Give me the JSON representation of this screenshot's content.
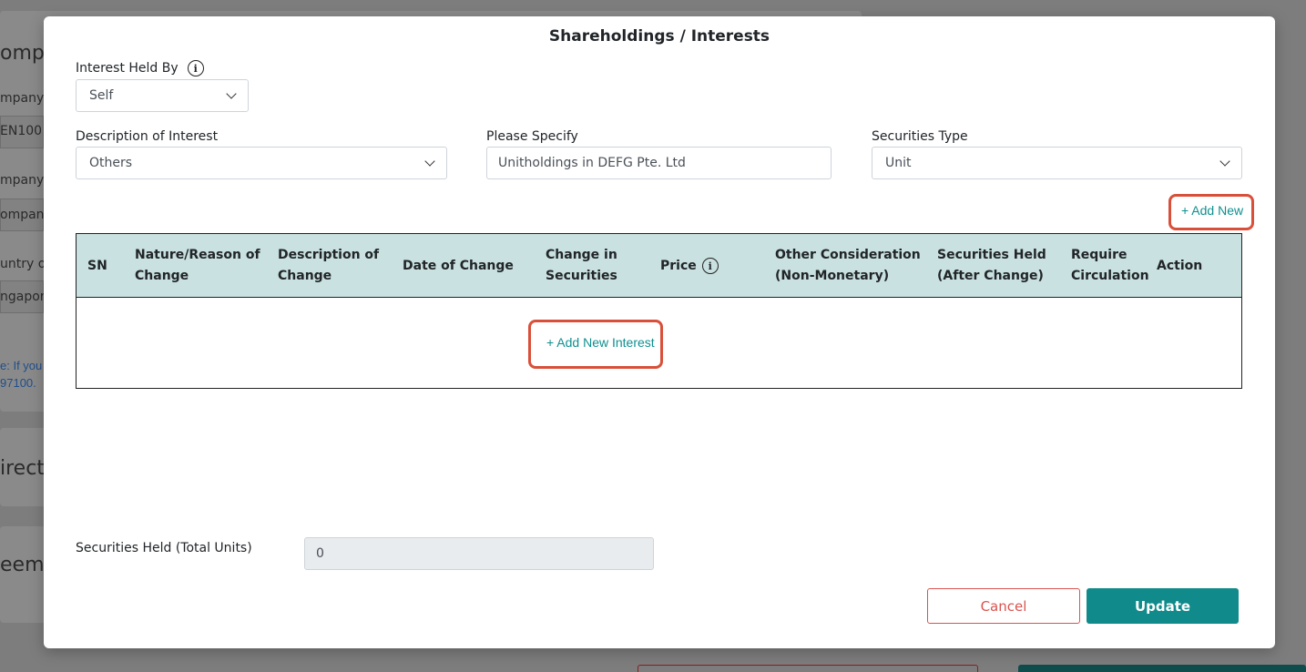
{
  "background": {
    "section_title": "ompa",
    "field1_label": "mpany",
    "field1_value": "EN100",
    "field2_label": "mpany",
    "field2_value": "ompan",
    "field3_label": "untry of",
    "field3_value": "ngapor",
    "note_line1": "e: If you",
    "note_line2": "97100.",
    "section2_title": "irect",
    "section3_title": "eeme"
  },
  "modal": {
    "title": "Shareholdings / Interests",
    "interest_held_by": {
      "label": "Interest Held By",
      "value": "Self"
    },
    "description_of_interest": {
      "label": "Description of Interest",
      "value": "Others"
    },
    "please_specify": {
      "label": "Please Specify",
      "value": "Unitholdings in DEFG Pte. Ltd"
    },
    "securities_type": {
      "label": "Securities Type",
      "value": "Unit"
    },
    "add_new_label": "+ Add New",
    "table": {
      "columns": [
        [
          "SN"
        ],
        [
          "Nature/Reason of",
          "Change"
        ],
        [
          "Description of",
          "Change"
        ],
        [
          "Date of Change"
        ],
        [
          "Change in",
          "Securities"
        ],
        [
          "Price"
        ],
        [
          "Other Consideration",
          "(Non-Monetary)"
        ],
        [
          "Securities Held",
          "(After Change)"
        ],
        [
          "Require",
          "Circulation"
        ],
        [
          "Action"
        ]
      ],
      "add_interest_label": "+ Add New Interest"
    },
    "securities_held_total": {
      "label": "Securities Held (Total Units)",
      "value": "0"
    },
    "cancel_label": "Cancel",
    "update_label": "Update"
  },
  "colors": {
    "accent": "#108a8a",
    "header_bg": "#c9e1e0",
    "highlight": "#d9503a",
    "cancel": "#d9534f"
  }
}
